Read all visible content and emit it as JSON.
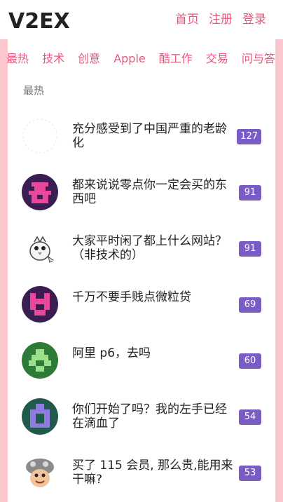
{
  "header": {
    "logo_text": "V2EX",
    "nav": [
      "首页",
      "注册",
      "登录"
    ]
  },
  "tabs": [
    "最热",
    "技术",
    "创意",
    "Apple",
    "酷工作",
    "交易",
    "问与答"
  ],
  "section_title": "最热",
  "topics": [
    {
      "title": "充分感受到了中国严重的老龄化",
      "replies": "127",
      "avatar": "loading-placeholder-icon"
    },
    {
      "title": "都来说说零点你一定会买的东西吧",
      "replies": "91",
      "avatar": "pink-pixel-avatar"
    },
    {
      "title": "大家平时闲了都上什么网站？（非技术的）",
      "replies": "91",
      "avatar": "cartoon-bird-avatar"
    },
    {
      "title": "千万不要手贱点微粒贷",
      "replies": "69",
      "avatar": "pink-pixel-avatar"
    },
    {
      "title": "阿里 p6，去吗",
      "replies": "60",
      "avatar": "green-pixel-avatar"
    },
    {
      "title": "你们开始了吗？我的左手已经在滴血了",
      "replies": "54",
      "avatar": "purple-pixel-avatar"
    },
    {
      "title": "买了 115 会员, 那么贵,能用来干嘛?",
      "replies": "53",
      "avatar": "mushroom-character-avatar"
    }
  ],
  "colors": {
    "accent": "#e8557a",
    "frame": "#fbc7cf",
    "badge": "#7b5cc4"
  }
}
